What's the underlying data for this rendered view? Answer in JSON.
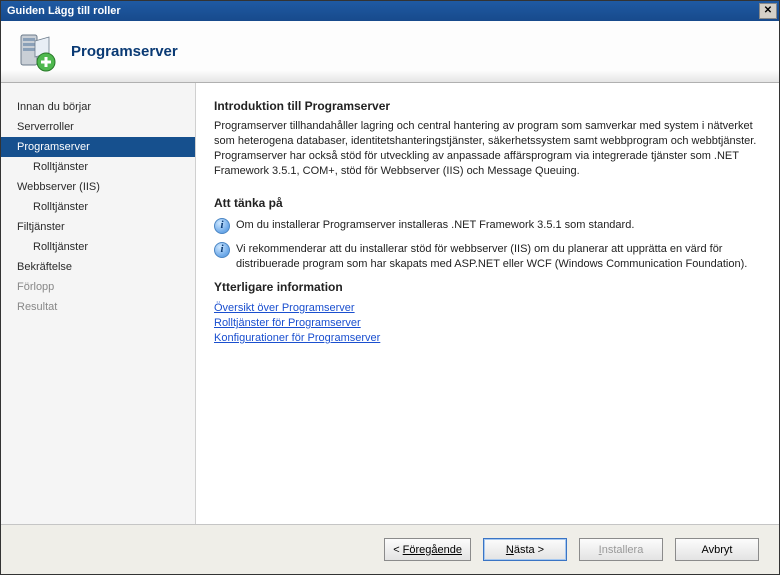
{
  "window": {
    "title": "Guiden Lägg till roller"
  },
  "header": {
    "title": "Programserver"
  },
  "sidebar": {
    "items": [
      {
        "label": "Innan du börjar",
        "selected": false,
        "sub": false,
        "disabled": false
      },
      {
        "label": "Serverroller",
        "selected": false,
        "sub": false,
        "disabled": false
      },
      {
        "label": "Programserver",
        "selected": true,
        "sub": false,
        "disabled": false
      },
      {
        "label": "Rolltjänster",
        "selected": false,
        "sub": true,
        "disabled": false
      },
      {
        "label": "Webbserver (IIS)",
        "selected": false,
        "sub": false,
        "disabled": false
      },
      {
        "label": "Rolltjänster",
        "selected": false,
        "sub": true,
        "disabled": false
      },
      {
        "label": "Filtjänster",
        "selected": false,
        "sub": false,
        "disabled": false
      },
      {
        "label": "Rolltjänster",
        "selected": false,
        "sub": true,
        "disabled": false
      },
      {
        "label": "Bekräftelse",
        "selected": false,
        "sub": false,
        "disabled": false
      },
      {
        "label": "Förlopp",
        "selected": false,
        "sub": false,
        "disabled": true
      },
      {
        "label": "Resultat",
        "selected": false,
        "sub": false,
        "disabled": true
      }
    ]
  },
  "content": {
    "intro_heading": "Introduktion till Programserver",
    "intro_text": "Programserver tillhandahåller lagring och central hantering av program som samverkar med system i nätverket som heterogena databaser, identitetshanteringstjänster, säkerhetssystem samt webbprogram och webbtjänster. Programserver har också stöd för utveckling av anpassade affärsprogram via integrerade tjänster som .NET Framework 3.5.1, COM+, stöd för Webbserver (IIS) och Message Queuing.",
    "consider_heading": "Att tänka på",
    "consider_items": [
      "Om du installerar Programserver installeras .NET Framework 3.5.1 som standard.",
      "Vi rekommenderar att du installerar stöd för webbserver (IIS) om du planerar att upprätta en värd för distribuerade program som har skapats med ASP.NET eller WCF (Windows Communication Foundation)."
    ],
    "more_heading": "Ytterligare information",
    "links": [
      "Översikt över Programserver",
      "Rolltjänster för Programserver",
      "Konfigurationer för Programserver"
    ]
  },
  "footer": {
    "prev": "Föregående",
    "next": "Nästa >",
    "install": "Installera",
    "cancel": "Avbryt"
  }
}
